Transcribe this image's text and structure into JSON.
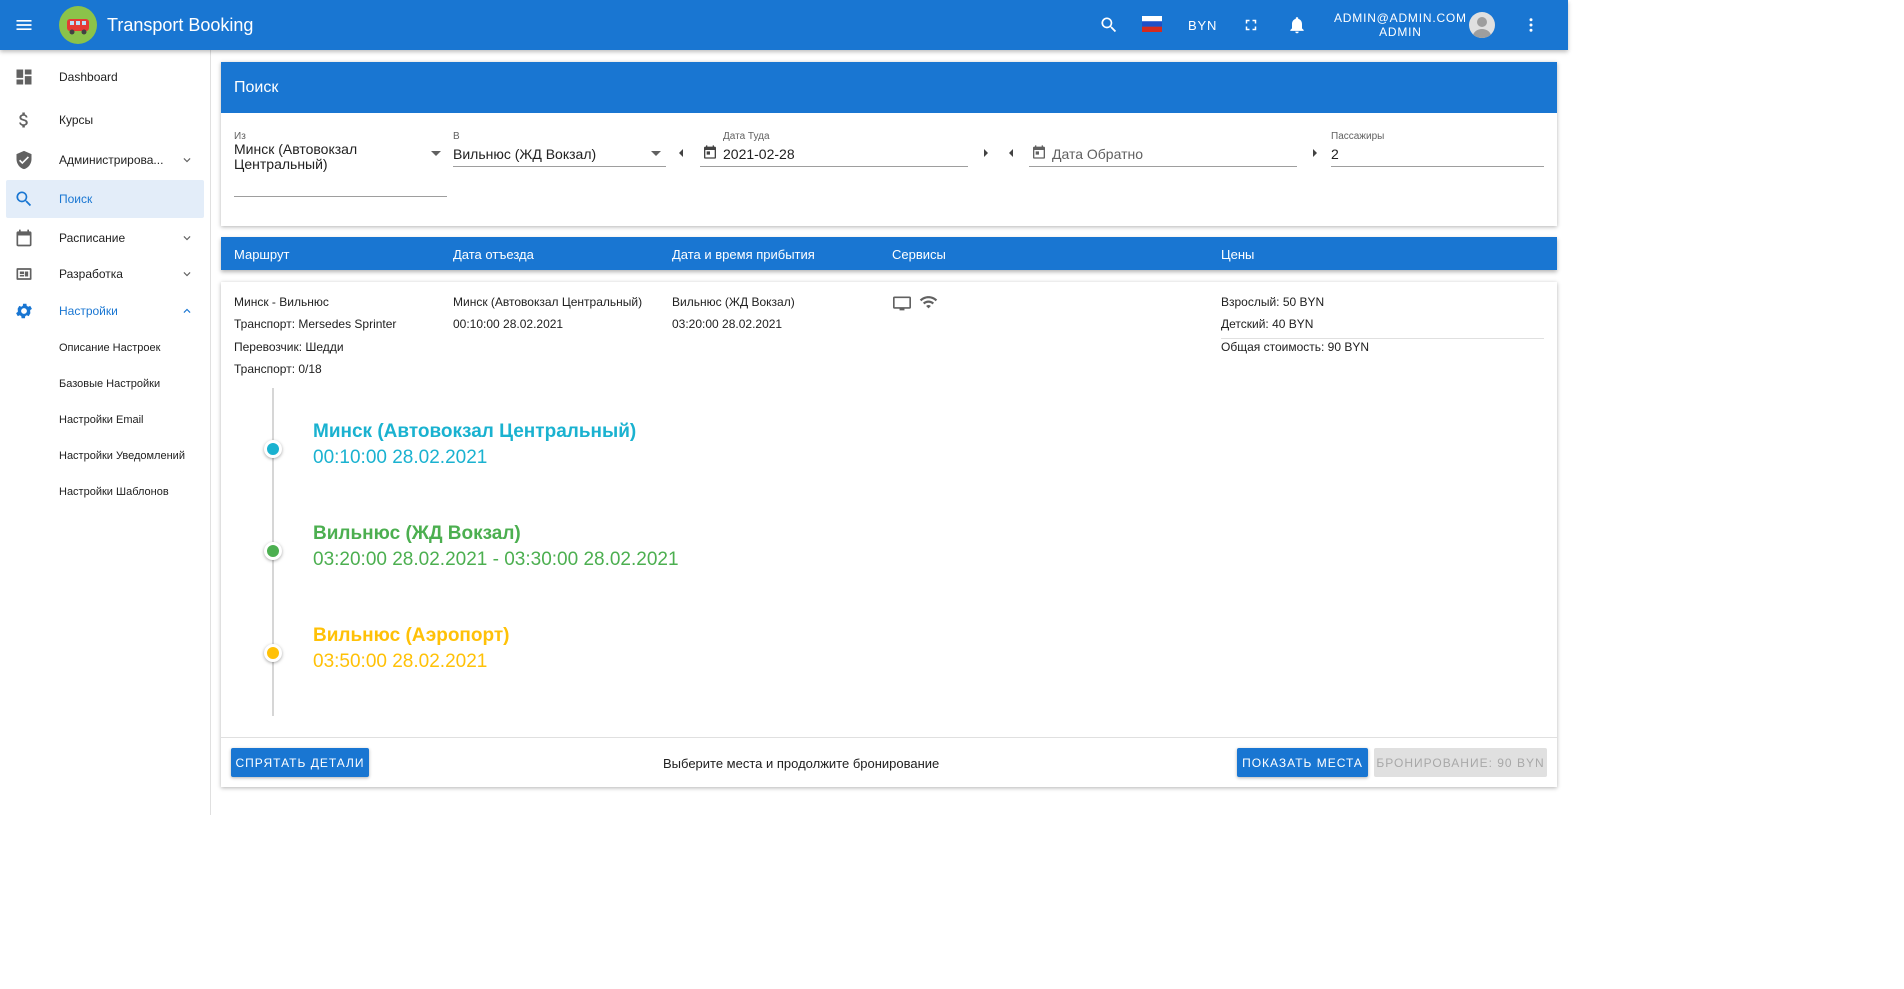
{
  "app": {
    "title": "Transport Booking",
    "currency": "BYN",
    "user_email": "ADMIN@ADMIN.COM",
    "user_role": "ADMIN",
    "accent_color": "#1976d2"
  },
  "sidebar": {
    "items": [
      {
        "label": "Dashboard",
        "icon": "dashboard-icon"
      },
      {
        "label": "Курсы",
        "icon": "dollar-icon"
      },
      {
        "label": "Администрирова...",
        "icon": "shield-icon"
      },
      {
        "label": "Поиск",
        "icon": "search-icon"
      },
      {
        "label": "Расписание",
        "icon": "calendar-icon"
      },
      {
        "label": "Разработка",
        "icon": "developer-board-icon"
      },
      {
        "label": "Настройки",
        "icon": "settings-icon"
      }
    ],
    "sub_items": [
      "Описание Настроек",
      "Базовые Настройки",
      "Настройки Email",
      "Настройки Уведомлений",
      "Настройки Шаблонов"
    ]
  },
  "search": {
    "header": "Поиск",
    "from_label": "Из",
    "from_value": "Минск (Автовокзал Центральный)",
    "to_label": "В",
    "to_value": "Вильнюс (ЖД Вокзал)",
    "date_there_label": "Дата Туда",
    "date_there_value": "2021-02-28",
    "date_back_placeholder": "Дата Обратно",
    "passengers_label": "Пассажиры",
    "passengers_value": "2"
  },
  "results": {
    "columns": [
      "Маршрут",
      "Дата отъезда",
      "Дата и время прибытия",
      "Сервисы",
      "Цены"
    ],
    "route": {
      "name": "Минск - Вильнюс",
      "transport": "Транспорт: Mersedes Sprinter",
      "carrier": "Перевозчик: Шедди",
      "seats": "Транспорт: 0/18"
    },
    "departure": {
      "station": "Минск (Автовокзал Центральный)",
      "time": "00:10:00 28.02.2021"
    },
    "arrival": {
      "station": "Вильнюс (ЖД Вокзал)",
      "time": "03:20:00 28.02.2021"
    },
    "services": [
      "tv-icon",
      "wifi-icon"
    ],
    "prices": {
      "adult": "Взрослый: 50 BYN",
      "child": "Детский: 40 BYN",
      "total": "Общая стоимость: 90 BYN"
    },
    "stops": [
      {
        "name": "Минск (Автовокзал Центральный)",
        "time": "00:10:00 28.02.2021",
        "color": "#1ab2d0"
      },
      {
        "name": "Вильнюс (ЖД Вокзал)",
        "time": "03:20:00 28.02.2021 - 03:30:00 28.02.2021",
        "color": "#4caf50"
      },
      {
        "name": "Вильнюс (Аэропорт)",
        "time": "03:50:00 28.02.2021",
        "color": "#ffc107"
      }
    ],
    "hide_details_button": "Спрятать детали",
    "hint": "Выберите места и продолжите бронирование",
    "show_seats_button": "Показать места",
    "booking_button": "Бронирование: 90 BYN"
  }
}
